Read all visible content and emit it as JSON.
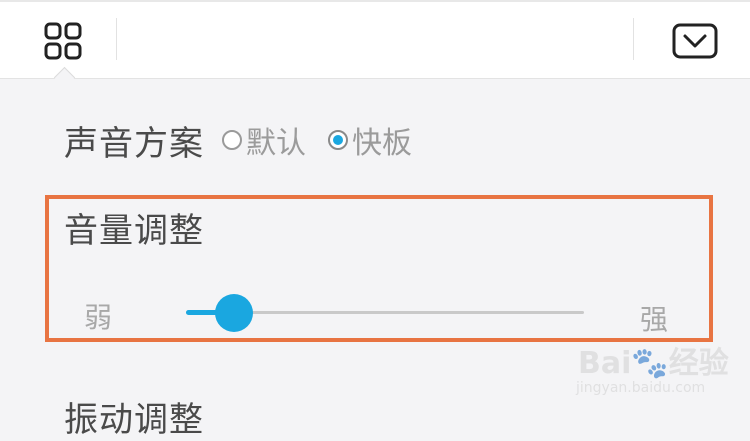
{
  "header": {
    "grid_icon": "apps-grid-icon",
    "mail_icon": "envelope-icon"
  },
  "sound_scheme": {
    "title": "声音方案",
    "options": [
      {
        "label": "默认",
        "selected": false
      },
      {
        "label": "快板",
        "selected": true
      }
    ]
  },
  "volume": {
    "title": "音量调整",
    "min_label": "弱",
    "max_label": "强",
    "level": 0.12
  },
  "vibration": {
    "title": "振动调整"
  },
  "watermark": {
    "brand": "Bai🐾经验",
    "url": "jingyan.baidu.com"
  },
  "colors": {
    "accent": "#1aa7e0",
    "highlight_border": "#e87442"
  }
}
